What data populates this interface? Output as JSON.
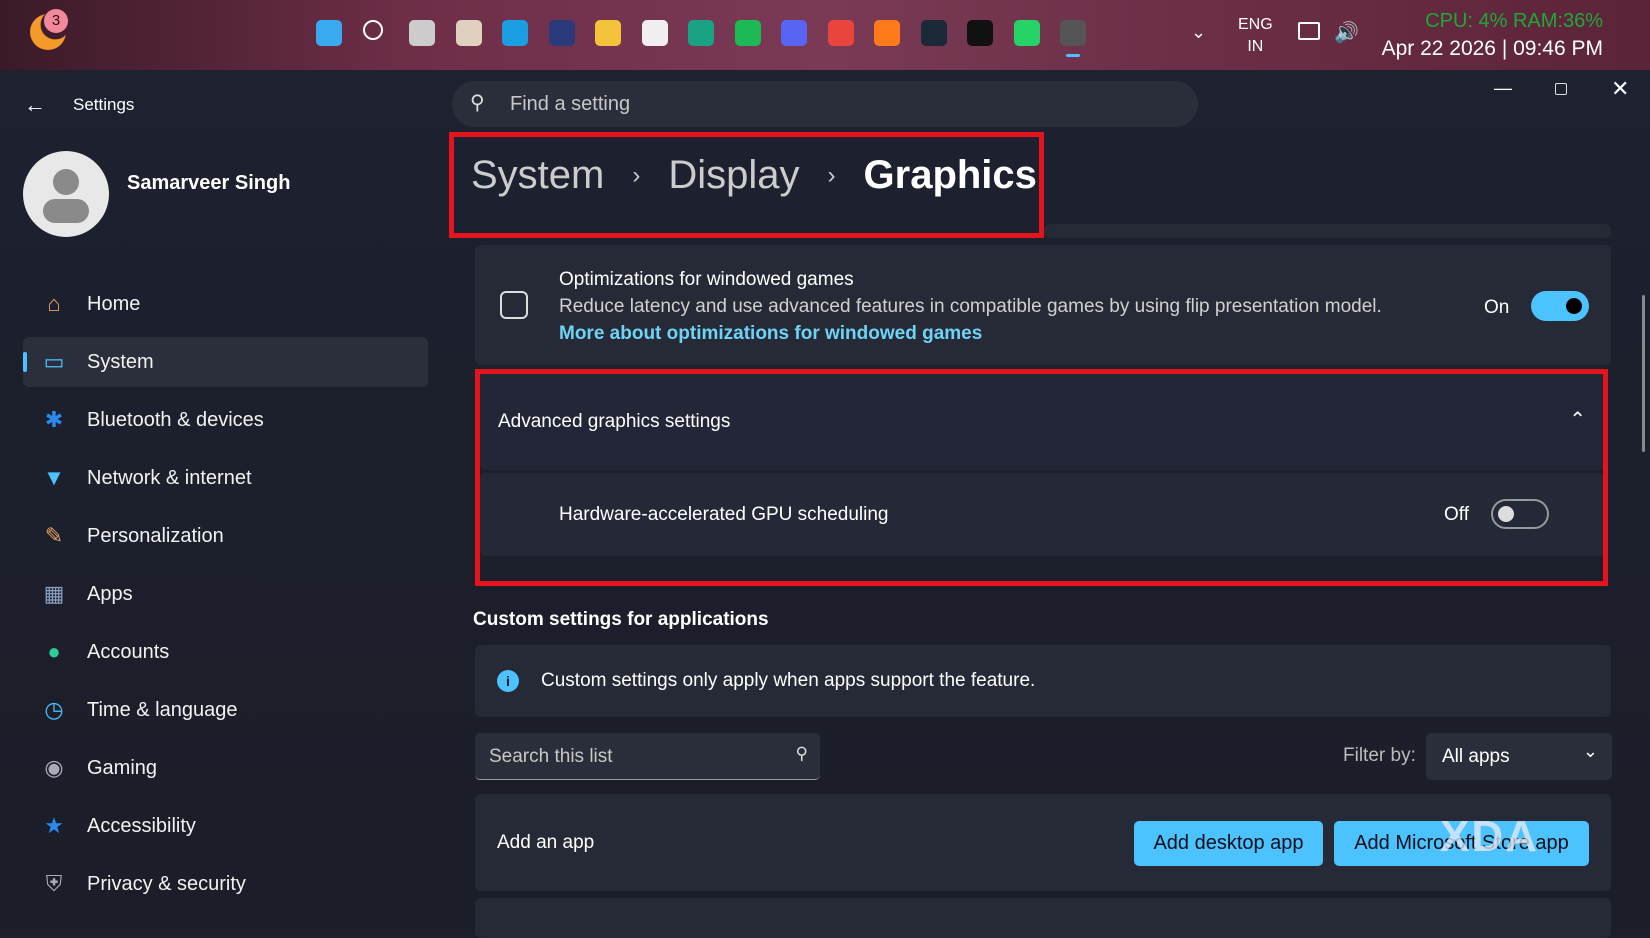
{
  "taskbar": {
    "notification_badge": "3",
    "apps": [
      "start",
      "search",
      "task-view",
      "paint",
      "edge",
      "app",
      "file-explorer",
      "store",
      "app-p",
      "spotify",
      "discord",
      "chrome",
      "firefox",
      "steam",
      "epic-games",
      "whatsapp",
      "settings"
    ],
    "language_line1": "ENG",
    "language_line2": "IN",
    "cpu_ram": "CPU:  4% RAM:36%",
    "datetime": "Apr 22 2026 | 09:46 PM",
    "accent": "#4cc2ff"
  },
  "window": {
    "title": "Settings",
    "search_placeholder": "Find a setting"
  },
  "user": {
    "name": "Samarveer Singh"
  },
  "sidebar": {
    "items": [
      {
        "label": "Home",
        "icon": "home-icon"
      },
      {
        "label": "System",
        "icon": "system-icon",
        "selected": true
      },
      {
        "label": "Bluetooth & devices",
        "icon": "bluetooth-icon"
      },
      {
        "label": "Network & internet",
        "icon": "wifi-icon"
      },
      {
        "label": "Personalization",
        "icon": "brush-icon"
      },
      {
        "label": "Apps",
        "icon": "apps-icon"
      },
      {
        "label": "Accounts",
        "icon": "accounts-icon"
      },
      {
        "label": "Time & language",
        "icon": "clock-icon"
      },
      {
        "label": "Gaming",
        "icon": "gamepad-icon"
      },
      {
        "label": "Accessibility",
        "icon": "accessibility-icon"
      },
      {
        "label": "Privacy & security",
        "icon": "shield-icon"
      }
    ]
  },
  "breadcrumb": [
    "System",
    "Display",
    "Graphics"
  ],
  "windowed_games": {
    "title": "Optimizations for windowed games",
    "description": "Reduce latency and use advanced features in compatible games by using flip presentation model.",
    "link": "More about optimizations for windowed games",
    "state": "On"
  },
  "advanced": {
    "title": "Advanced graphics settings",
    "gpu_label": "Hardware-accelerated GPU scheduling",
    "gpu_state": "Off"
  },
  "custom": {
    "section_title": "Custom settings for applications",
    "info": "Custom settings only apply when apps support the feature.",
    "search_placeholder": "Search this list",
    "filter_label": "Filter by:",
    "filter_value": "All apps",
    "add_app_label": "Add an app",
    "add_desktop": "Add desktop app",
    "add_store": "Add Microsoft Store app"
  },
  "watermark": "XDA"
}
